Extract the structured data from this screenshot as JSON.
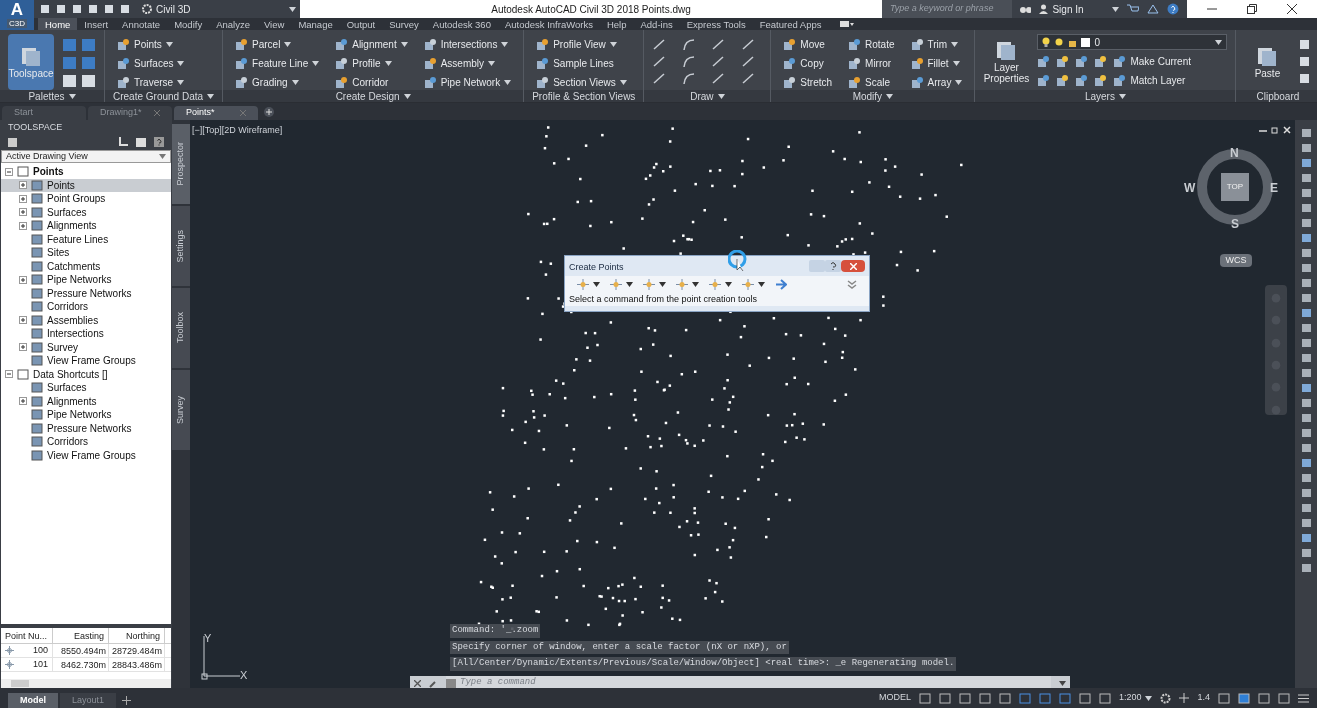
{
  "title_bar": {
    "app_letter": "A",
    "app_badge": "C3D",
    "workspace": "Civil 3D",
    "title": "Autodesk AutoCAD Civil 3D 2018  Points.dwg",
    "search_placeholder": "Type a keyword or phrase",
    "sign_in": "Sign In"
  },
  "ribbon_tabs": [
    {
      "label": "Home",
      "selected": true
    },
    {
      "label": "Insert",
      "selected": false
    },
    {
      "label": "Annotate",
      "selected": false
    },
    {
      "label": "Modify",
      "selected": false
    },
    {
      "label": "Analyze",
      "selected": false
    },
    {
      "label": "View",
      "selected": false
    },
    {
      "label": "Manage",
      "selected": false
    },
    {
      "label": "Output",
      "selected": false
    },
    {
      "label": "Survey",
      "selected": false
    },
    {
      "label": "Autodesk 360",
      "selected": false
    },
    {
      "label": "Autodesk InfraWorks",
      "selected": false
    },
    {
      "label": "Help",
      "selected": false
    },
    {
      "label": "Add-ins",
      "selected": false
    },
    {
      "label": "Express Tools",
      "selected": false
    },
    {
      "label": "Featured Apps",
      "selected": false
    }
  ],
  "ribbon_panels": [
    {
      "title": "Palettes",
      "menu": true,
      "large": {
        "label": "Toolspace",
        "active": true
      }
    },
    {
      "title": "Create Ground Data",
      "menu": true,
      "columns": [
        [
          {
            "label": "Points",
            "dropdown": true
          },
          {
            "label": "Surfaces",
            "dropdown": true
          },
          {
            "label": "Traverse",
            "dropdown": true
          }
        ]
      ]
    },
    {
      "title": "Create Design",
      "menu": true,
      "columns": [
        [
          {
            "label": "Parcel",
            "dropdown": true
          },
          {
            "label": "Feature Line",
            "dropdown": true
          },
          {
            "label": "Grading",
            "dropdown": true
          }
        ],
        [
          {
            "label": "Alignment",
            "dropdown": true
          },
          {
            "label": "Profile",
            "dropdown": true
          },
          {
            "label": "Corridor",
            "dropdown": false
          }
        ],
        [
          {
            "label": "Intersections",
            "dropdown": true
          },
          {
            "label": "Assembly",
            "dropdown": true
          },
          {
            "label": "Pipe Network",
            "dropdown": true
          }
        ]
      ]
    },
    {
      "title": "Profile & Section Views",
      "menu": false,
      "columns": [
        [
          {
            "label": "Profile View",
            "dropdown": true
          },
          {
            "label": "Sample Lines",
            "dropdown": false
          },
          {
            "label": "Section Views",
            "dropdown": true
          }
        ]
      ]
    },
    {
      "title": "Draw",
      "menu": true
    },
    {
      "title": "Modify",
      "menu": true,
      "columns": [
        [
          {
            "label": "Move",
            "dropdown": false
          },
          {
            "label": "Copy",
            "dropdown": false
          },
          {
            "label": "Stretch",
            "dropdown": false
          }
        ],
        [
          {
            "label": "Rotate",
            "dropdown": false
          },
          {
            "label": "Mirror",
            "dropdown": false
          },
          {
            "label": "Scale",
            "dropdown": false
          }
        ],
        [
          {
            "label": "Trim",
            "dropdown": true
          },
          {
            "label": "Fillet",
            "dropdown": true
          },
          {
            "label": "Array",
            "dropdown": true
          }
        ]
      ]
    },
    {
      "title": "Layers",
      "menu": true,
      "large": {
        "label": "Layer Properties",
        "active": false
      },
      "layer_value": "0",
      "columns": [
        [
          {
            "label": "Make Current",
            "dropdown": false
          },
          {
            "label": "Match Layer",
            "dropdown": false
          }
        ]
      ]
    },
    {
      "title": "Clipboard",
      "menu": false,
      "large": {
        "label": "Paste",
        "active": false
      }
    }
  ],
  "document_tabs": [
    {
      "label": "Start",
      "selected": false
    },
    {
      "label": "Drawing1*",
      "selected": false
    },
    {
      "label": "Points*",
      "selected": true
    }
  ],
  "toolspace": {
    "title": "TOOLSPACE",
    "view": "Active Drawing View",
    "tree": [
      {
        "label": "Points",
        "bold": true,
        "expanded": true,
        "children": [
          {
            "label": "Points",
            "expanded": false,
            "selected": true
          },
          {
            "label": "Point Groups",
            "expanded": false,
            "selected": false
          },
          {
            "label": "Surfaces",
            "expanded": false,
            "selected": false
          },
          {
            "label": "Alignments",
            "expanded": false,
            "selected": false
          },
          {
            "label": "Feature Lines",
            "selected": false
          },
          {
            "label": "Sites",
            "selected": false
          },
          {
            "label": "Catchments",
            "selected": false
          },
          {
            "label": "Pipe Networks",
            "expanded": false,
            "selected": false
          },
          {
            "label": "Pressure Networks",
            "selected": false
          },
          {
            "label": "Corridors",
            "selected": false
          },
          {
            "label": "Assemblies",
            "expanded": false,
            "selected": false
          },
          {
            "label": "Intersections",
            "selected": false
          },
          {
            "label": "Survey",
            "expanded": false,
            "selected": false
          },
          {
            "label": "View Frame Groups",
            "selected": false
          }
        ]
      },
      {
        "label": "Data Shortcuts []",
        "bold": false,
        "expanded": true,
        "children": [
          {
            "label": "Surfaces",
            "selected": false
          },
          {
            "label": "Alignments",
            "expanded": false,
            "selected": false
          },
          {
            "label": "Pipe Networks",
            "selected": false
          },
          {
            "label": "Pressure Networks",
            "selected": false
          },
          {
            "label": "Corridors",
            "selected": false
          },
          {
            "label": "View Frame Groups",
            "selected": false
          }
        ]
      }
    ],
    "side_tabs": [
      {
        "label": "Prospector",
        "selected": true
      },
      {
        "label": "Settings",
        "selected": false
      },
      {
        "label": "Toolbox",
        "selected": false
      },
      {
        "label": "Survey",
        "selected": false
      }
    ],
    "point_table": {
      "columns": [
        "Point Nu...",
        "Easting",
        "Northing"
      ],
      "rows": [
        [
          "100",
          "8550.494m",
          "28729.484m"
        ],
        [
          "101",
          "8462.730m",
          "28843.486m"
        ]
      ]
    }
  },
  "viewport": {
    "label": "[−][Top][2D Wireframe]",
    "viewcube": {
      "north": "N",
      "south": "S",
      "east": "E",
      "west": "W",
      "face": "TOP",
      "ucs": "WCS"
    },
    "ucs_axes": {
      "y": "Y",
      "x": "X"
    }
  },
  "create_points_dialog": {
    "title": "Create Points",
    "message": "Select a command from the point creation tools"
  },
  "command_line": {
    "history": [
      "Command: '_.zoom",
      "Specify corner of window, enter a scale factor (nX or nXP), or",
      "[All/Center/Dynamic/Extents/Previous/Scale/Window/Object] <real time>: _e Regenerating model."
    ],
    "placeholder": "Type a command"
  },
  "layout_tabs": [
    {
      "label": "Model",
      "selected": true
    },
    {
      "label": "Layout1",
      "selected": false
    }
  ],
  "status_bar": {
    "space": "MODEL",
    "scale": "1:200",
    "lineweight": "1.4"
  }
}
